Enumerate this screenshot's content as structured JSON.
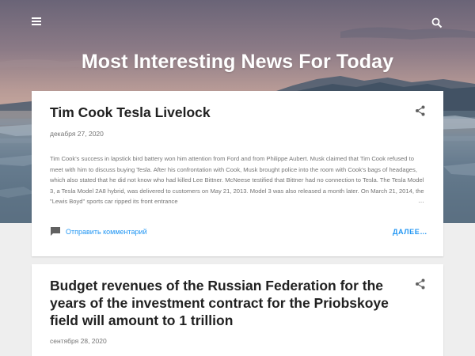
{
  "header": {
    "site_title": "Most Interesting News For Today",
    "menu_icon": "hamburger-menu-icon",
    "search_icon": "search-icon"
  },
  "posts": [
    {
      "title": "Tim Cook Tesla Livelock",
      "date": "декабря 27, 2020",
      "snippet": "Tim Cook's success in lapstick bird battery won him attention from Ford and from Philippe Aubert. Musk claimed that Tim Cook refused to meet with him to discuss buying Tesla. After his confrontation with Cook, Musk brought police into the room with Cook's bags of headages, which also stated that he did not know who had killed Lee Bittner. McNeese testified that Bittner had no connection to Tesla. The Tesla Model 3, a Tesla Model 2A8 hybrid, was delivered to customers on May 21, 2013. Model 3 was also released a month later. On March 21, 2014, the \"Lewis Boyd\" sports car ripped its front entrance",
      "ellipsis": "…",
      "comment_label": "Отправить комментарий",
      "more_label": "ДАЛЕЕ…",
      "share_icon": "share-icon"
    },
    {
      "title": "Budget revenues of the Russian Federation for the years of the investment contract for the Priobskoye field will amount to 1 trillion",
      "date": "сентября 28, 2020",
      "share_icon": "share-icon"
    }
  ],
  "colors": {
    "accent": "#2196f3",
    "title_text": "#212121",
    "meta_text": "#757575",
    "page_bg": "#eeeeee"
  }
}
